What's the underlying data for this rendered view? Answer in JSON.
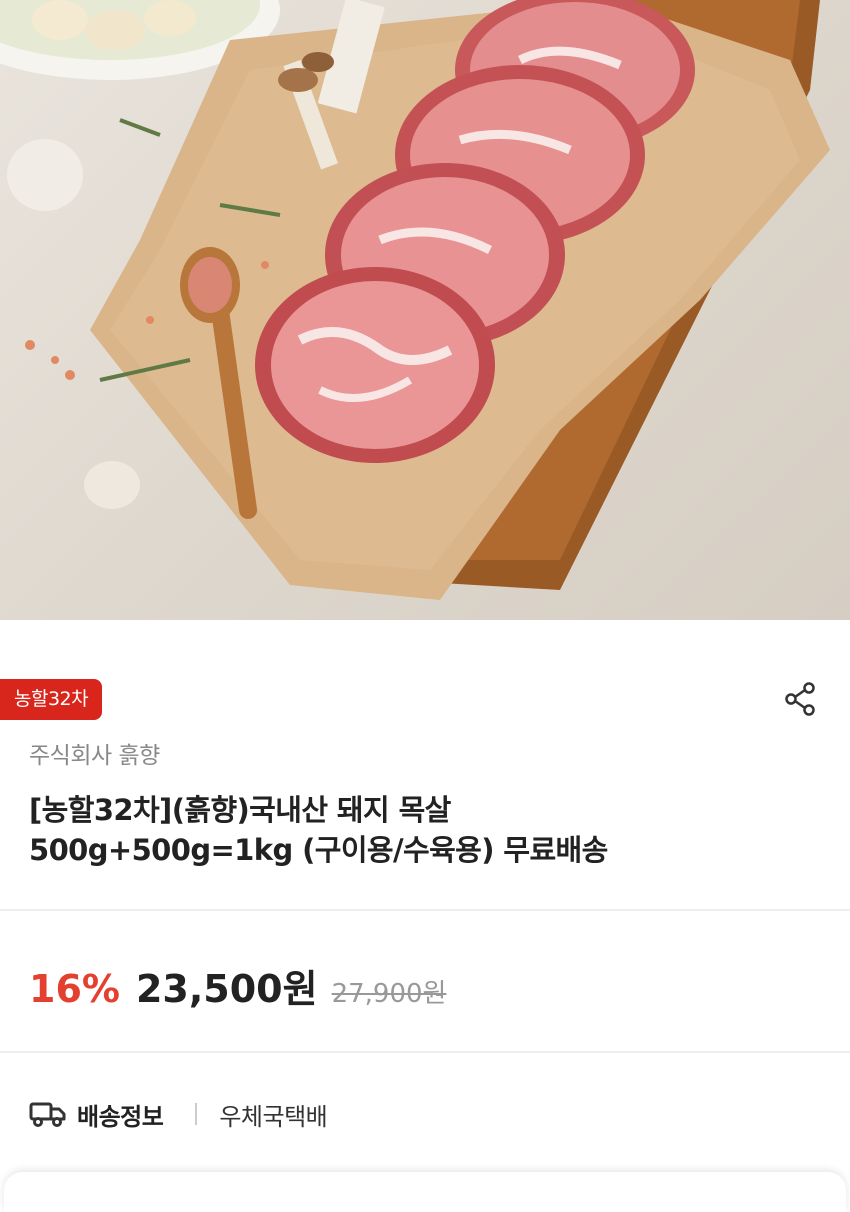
{
  "product": {
    "badge": "농할32차",
    "seller": "주식회사 흙향",
    "title_line1": "[농할32차](흙향)국내산 돼지 목살",
    "title_line2": "500g+500g=1kg (구이용/수육용) 무료배송",
    "image_alt": "국내산 돼지 목살"
  },
  "price": {
    "discount": "16%",
    "sale": "23,500원",
    "original": "27,900원"
  },
  "shipping": {
    "label": "배송정보",
    "value": "우체국택배"
  },
  "icons": {
    "share": "share-icon",
    "truck": "truck-icon"
  },
  "colors": {
    "badge": "#d9261c",
    "discount": "#e3402f"
  }
}
